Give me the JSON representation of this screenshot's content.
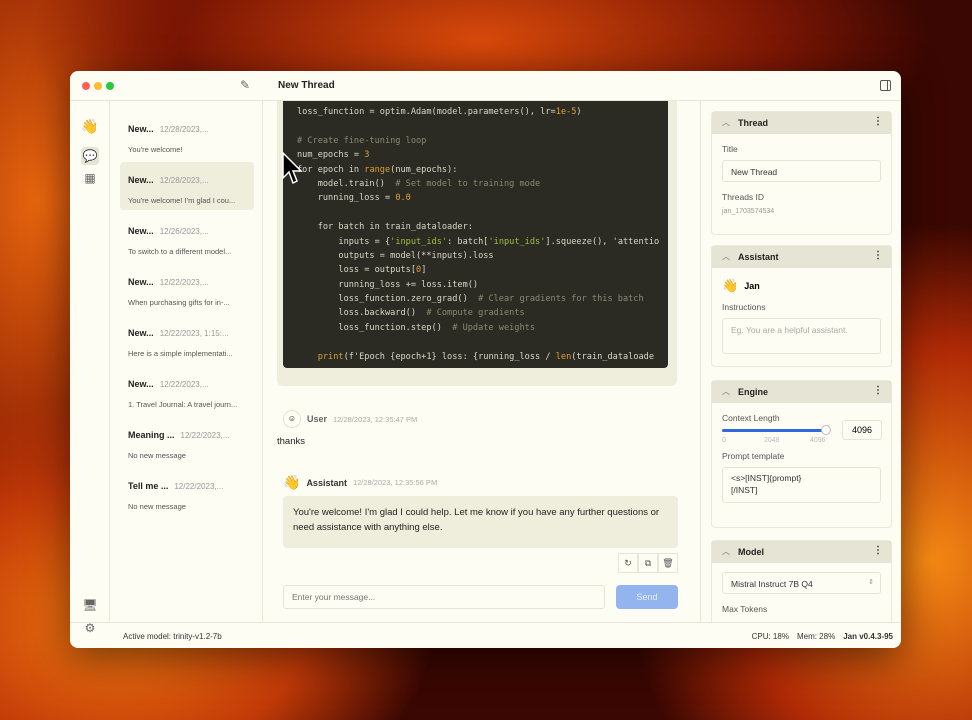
{
  "window": {
    "title": "New Thread"
  },
  "threads": [
    {
      "name": "New...",
      "date": "12/28/2023,...",
      "msg": "You're welcome!"
    },
    {
      "name": "New...",
      "date": "12/28/2023,...",
      "msg": "You're welcome! I'm glad I cou...",
      "selected": true
    },
    {
      "name": "New...",
      "date": "12/26/2023,...",
      "msg": "To switch to a different model..."
    },
    {
      "name": "New...",
      "date": "12/22/2023,...",
      "msg": "When purchasing gifts for in-..."
    },
    {
      "name": "New...",
      "date": "12/22/2023, 1:15:...",
      "msg": "Here is a simple implementati..."
    },
    {
      "name": "New...",
      "date": "12/22/2023,...",
      "msg": "1. Travel Journal: A travel journ..."
    },
    {
      "name": "Meaning ...",
      "date": "12/22/2023,...",
      "msg": "No new message"
    },
    {
      "name": "Tell me ...",
      "date": "12/22/2023,...",
      "msg": "No new message"
    }
  ],
  "code": {
    "lines": [
      "loss_function = optim.Adam(model.parameters(), lr=1e-5)",
      "",
      "# Create fine-tuning loop",
      "num_epochs = 3",
      "for epoch in range(num_epochs):",
      "    model.train()  # Set model to training mode",
      "    running_loss = 0.0",
      "",
      "    for batch in train_dataloader:",
      "        inputs = {'input_ids': batch['input_ids'].squeeze(), 'attentio",
      "        outputs = model(**inputs).loss",
      "        loss = outputs[0]",
      "        running_loss += loss.item()",
      "        loss_function.zero_grad()  # Clear gradients for this batch",
      "        loss.backward()  # Compute gradients",
      "        loss_function.step()  # Update weights",
      "",
      "    print(f'Epoch {epoch+1} loss: {running_loss / len(train_dataloade"
    ]
  },
  "messages": {
    "user": {
      "name": "User",
      "time": "12/28/2023, 12:35:47 PM",
      "text": "thanks"
    },
    "assistant": {
      "name": "Assistant",
      "time": "12/28/2023, 12:35:56 PM",
      "text": "You're welcome! I'm glad I could help. Let me know if you have any further questions or need assistance with anything else."
    }
  },
  "composer": {
    "placeholder": "Enter your message...",
    "send_label": "Send"
  },
  "right": {
    "thread": {
      "header": "Thread",
      "title_label": "Title",
      "title_value": "New Thread",
      "id_label": "Threads ID",
      "id_value": "jan_1703574534"
    },
    "assistant": {
      "header": "Assistant",
      "name": "Jan",
      "instructions_label": "Instructions",
      "instructions_placeholder": "Eg. You are a helpful assistant."
    },
    "engine": {
      "header": "Engine",
      "context_label": "Context Length",
      "context_value": "4096",
      "context_fraction": 1.0,
      "ticks": [
        "0",
        "2048",
        "4096"
      ],
      "prompt_label": "Prompt template",
      "prompt_value": "<s>[INST]{prompt}\n[/INST]"
    },
    "model": {
      "header": "Model",
      "selected": "Mistral Instruct 7B Q4",
      "max_tokens_label": "Max Tokens"
    }
  },
  "status": {
    "active_model": "Active model: trinity-v1.2-7b",
    "cpu": "CPU: 18%",
    "mem": "Mem: 28%",
    "version": "Jan v0.4.3-95"
  },
  "colors": {
    "accent": "#2f6ae0",
    "send": "#93b4ee"
  }
}
